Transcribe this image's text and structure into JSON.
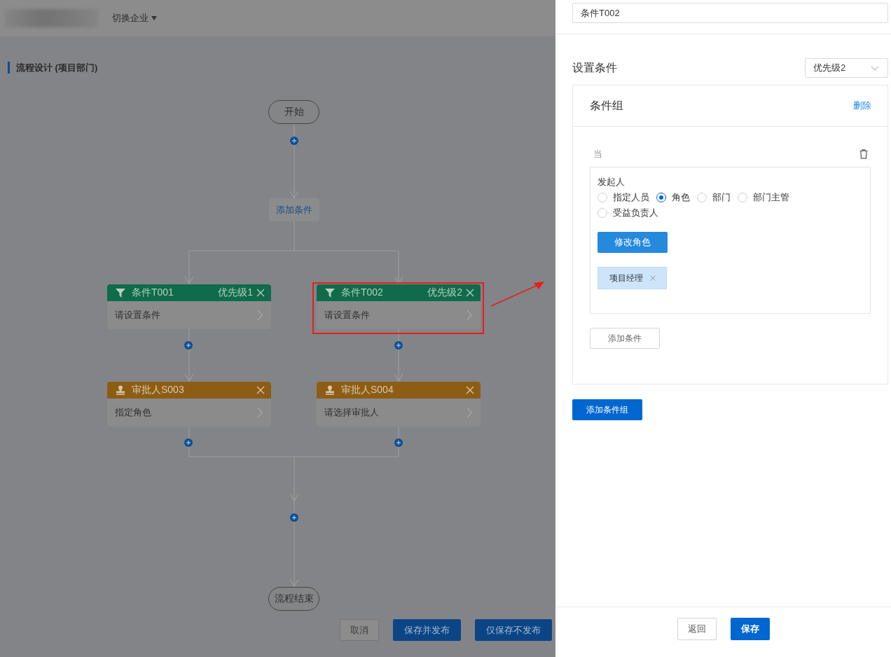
{
  "header": {
    "switch_label": "切换企业"
  },
  "page_title": "流程设计 (项目部门)",
  "flow": {
    "start": "开始",
    "add_condition": "添加条件",
    "branches": [
      {
        "condition": {
          "kind": "condition",
          "title": "条件T001",
          "priority": "优先级1",
          "body": "请设置条件",
          "highlighted": false
        },
        "approver": {
          "kind": "approver",
          "title": "审批人S003",
          "body": "指定角色"
        }
      },
      {
        "condition": {
          "kind": "condition",
          "title": "条件T002",
          "priority": "优先级2",
          "body": "请设置条件",
          "highlighted": true
        },
        "approver": {
          "kind": "approver",
          "title": "审批人S004",
          "body": "请选择审批人"
        }
      }
    ],
    "end": "流程结束"
  },
  "footer_buttons": [
    {
      "label": "取消",
      "kind": "default"
    },
    {
      "label": "保存并发布",
      "kind": "primary"
    },
    {
      "label": "仅保存不发布",
      "kind": "primary"
    }
  ],
  "panel": {
    "name_value": "条件T002",
    "section_title": "设置条件",
    "priority_select": "优先级2",
    "group": {
      "title": "条件组",
      "delete": "删除",
      "when": "当",
      "field_label": "发起人",
      "options": [
        {
          "label": "指定人员",
          "selected": false
        },
        {
          "label": "角色",
          "selected": true
        },
        {
          "label": "部门",
          "selected": false
        },
        {
          "label": "部门主管",
          "selected": false
        },
        {
          "label": "受益负责人",
          "selected": false
        }
      ],
      "modify_button": "修改角色",
      "tags": [
        {
          "label": "项目经理"
        }
      ],
      "add_condition": "添加条件"
    },
    "add_group": "添加条件组",
    "buttons": [
      {
        "label": "返回",
        "kind": "default"
      },
      {
        "label": "保存",
        "kind": "primary"
      }
    ]
  }
}
